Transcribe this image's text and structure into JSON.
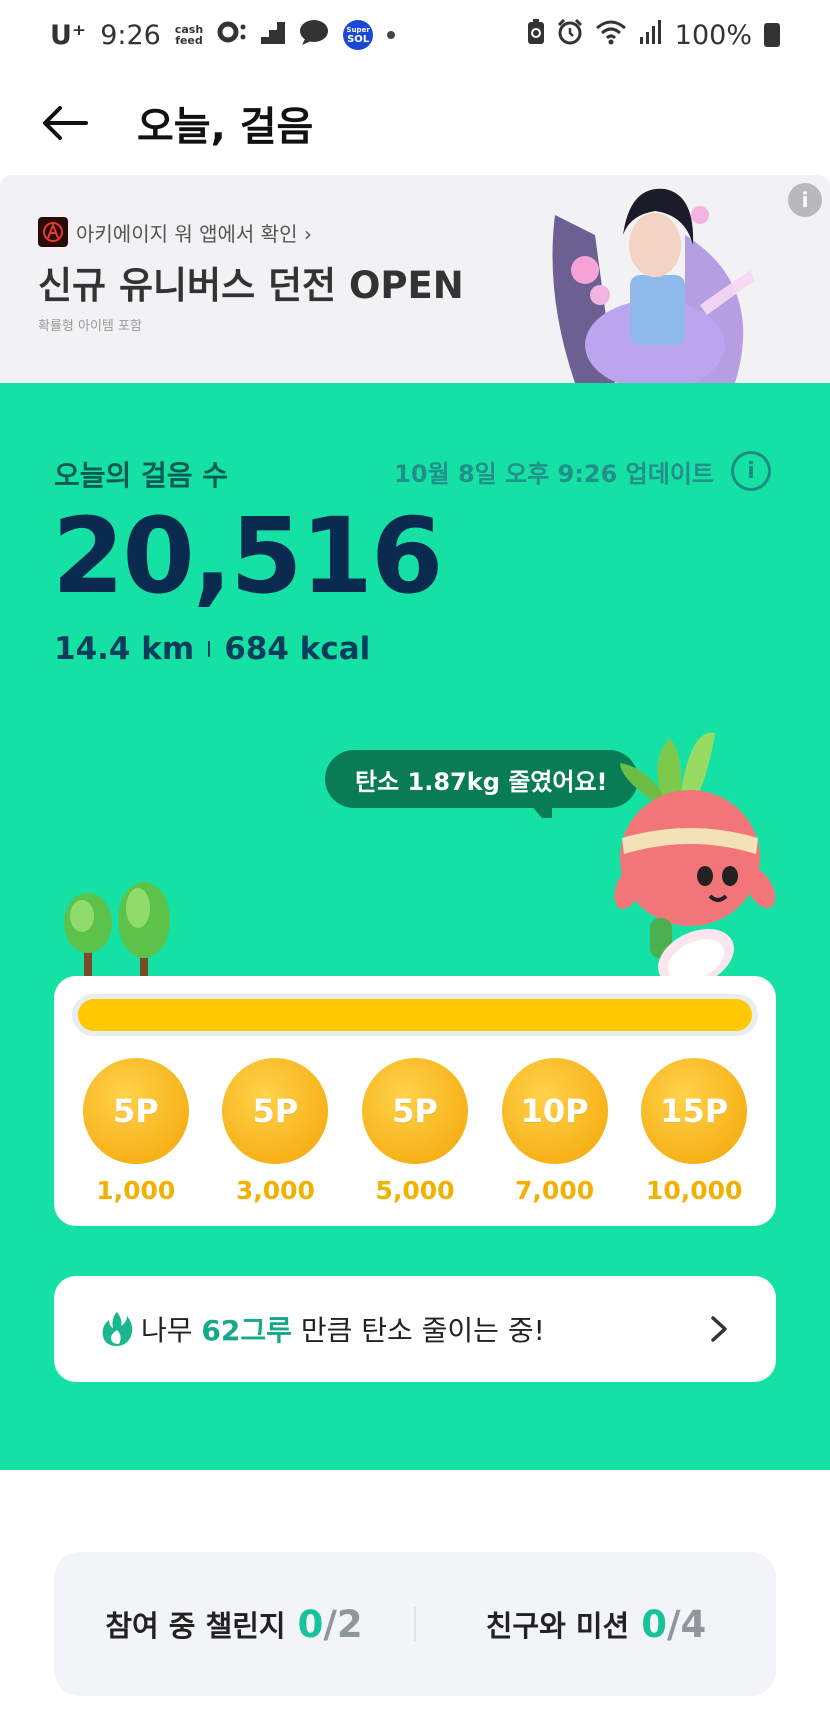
{
  "status_bar": {
    "carrier": "U⁺",
    "time": "9:26",
    "cashfeed_label_1": "cash",
    "cashfeed_label_2": "feed",
    "sol_label_1": "Super",
    "sol_label_2": "SOL",
    "battery": "100%"
  },
  "header": {
    "title": "오늘, 걸음"
  },
  "banner": {
    "brand_link": "아키에이지 워 앱에서 확인 ›",
    "title": "신규 유니버스 던전 OPEN",
    "note": "확률형 아이템 포함",
    "info_icon": "i"
  },
  "steps": {
    "label": "오늘의 걸음 수",
    "updated": "10월 8일 오후 9:26 업데이트",
    "count": "20,516",
    "distance": "14.4 km",
    "calories": "684 kcal"
  },
  "mascot": {
    "speech": "탄소 1.87kg 줄였어요!"
  },
  "rewards": {
    "progress_fraction": 1.0,
    "milestones": [
      {
        "points": "5P",
        "steps": "1,000"
      },
      {
        "points": "5P",
        "steps": "3,000"
      },
      {
        "points": "5P",
        "steps": "5,000"
      },
      {
        "points": "10P",
        "steps": "7,000"
      },
      {
        "points": "15P",
        "steps": "10,000"
      }
    ]
  },
  "carbon": {
    "prefix": "나무 ",
    "highlight": "62그루",
    "suffix": " 만큼 탄소 줄이는 중!"
  },
  "challenges": {
    "joined_label": "참여 중 챌린지",
    "joined_current": "0",
    "joined_total": "/2",
    "friends_label": "친구와 미션",
    "friends_current": "0",
    "friends_total": "/4"
  },
  "colors": {
    "accent_green": "#16e1a4",
    "coin_gold": "#f7b21a",
    "progress_yellow": "#ffc800",
    "dark_navy": "#0a2b4f"
  }
}
